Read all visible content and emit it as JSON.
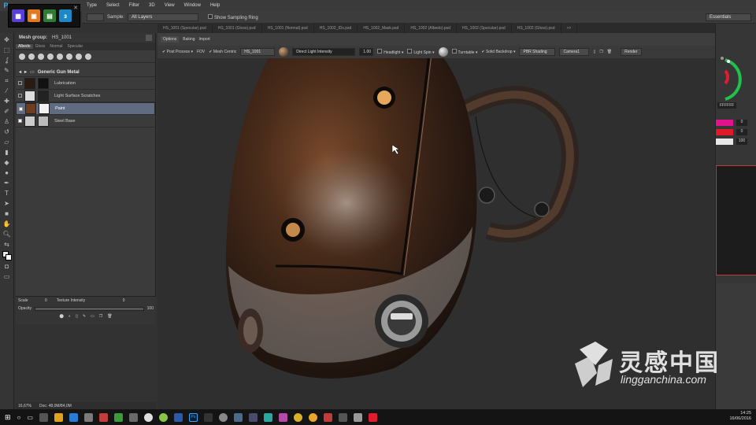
{
  "menubar": {
    "app": "Ps",
    "items": [
      "Type",
      "Select",
      "Filter",
      "3D",
      "View",
      "Window",
      "Help"
    ]
  },
  "options": {
    "sample_label": "Sample:",
    "sample_value": "All Layers",
    "sampling_ring": "Show Sampling Ring",
    "workspace": "Essentials"
  },
  "doc_tabs": [
    "HS_1001 (Specular).psd",
    "HS_1001 (Gloss).psd",
    "HS_1001 (Normal).psd",
    "HS_1002_IDs.psd",
    "HS_1002_Mask.psd",
    "HS_1002 (Albedo).psd",
    "HS_1002 (Specular).psd",
    "HS_1002 (Gloss).psd",
    ">>"
  ],
  "panel": {
    "mesh_group_label": "Mesh group:",
    "mesh_group_value": "HS_1001",
    "tabs": [
      "Albedo",
      "Gloss",
      "Normal",
      "Specular"
    ],
    "group_name": "Generic Gun Metal",
    "layers": [
      {
        "name": "Lubrication",
        "selected": false
      },
      {
        "name": "Light Surface Scratches",
        "selected": false
      },
      {
        "name": "Paint",
        "selected": true
      },
      {
        "name": "Steel Base",
        "selected": false
      }
    ],
    "footer": {
      "scale_label": "Scale",
      "scale_value": "0",
      "texture_label": "Texture Intensity",
      "texture_value": "0",
      "opacity_label": "Opacity",
      "opacity_value": "100"
    }
  },
  "viewport": {
    "tabs": [
      "Options",
      "Baking",
      "Import"
    ],
    "toolbar": {
      "post_process": "Post Process",
      "fov": "FOV",
      "mesh_centric": "Mesh Centric",
      "mesh": "HS_1001",
      "light_field": "Direct Light Intensity",
      "light_value": "1.00",
      "headlight": "Headlight",
      "light_spin": "Light Spin",
      "turntable": "Turntable",
      "solid_backdrop": "Solid Backdrop",
      "shading": "PBR Shading",
      "camera": "Camera1",
      "render": "Render"
    }
  },
  "right": {
    "hex": "FFFFFF",
    "val1": "0",
    "val2": "0",
    "val3": "100"
  },
  "status": {
    "zoom": "16,67%",
    "doc": "Doc: 48,0M/84,0M"
  },
  "taskbar": {
    "time": "14:25",
    "date": "16/06/2016"
  },
  "watermark": {
    "cn": "灵感中国",
    "en": "lingganchina.com"
  },
  "colors": {
    "accent": "#31a8ff",
    "selected_layer": "#5e6b80",
    "magenta": "#e0128e",
    "red": "#e0192b"
  }
}
